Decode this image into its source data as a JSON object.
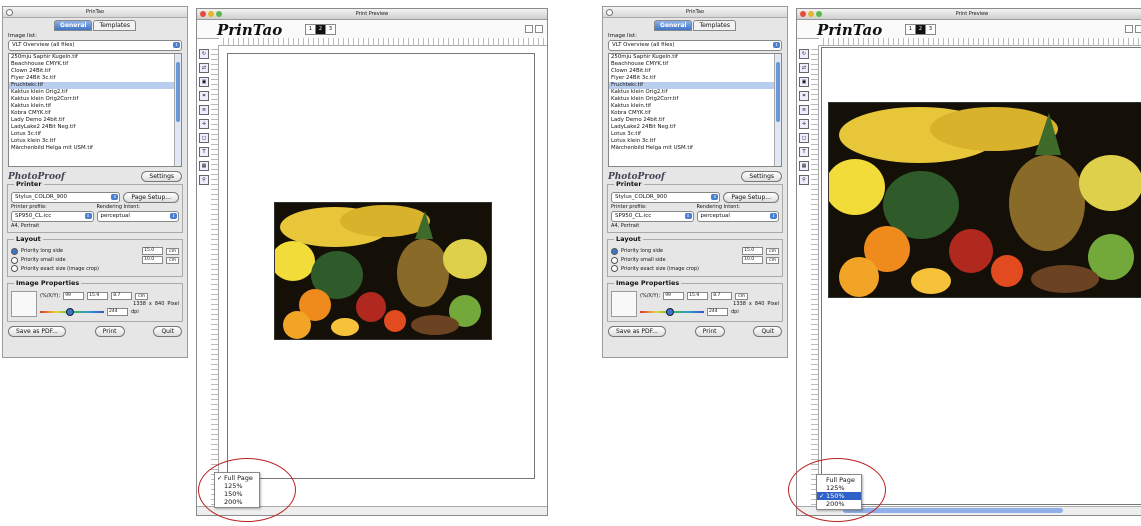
{
  "panel": {
    "title": "PrinTao",
    "tabs": [
      "General",
      "Templates"
    ],
    "image_list_label": "Image list:",
    "image_list_select": "VLT Overview (all files)",
    "files": [
      "250mju Saphir Kugeln.tif",
      "Beachhouse CMYK.tif",
      "Clown 24Bit.tif",
      "Flyer 24Bit 3c.tif",
      "Fruchteki.tif",
      "Kaktus klein Orig2.tif",
      "Kaktus klein Orig2Corr.tif",
      "Kaktus klein.tif",
      "Kobra CMYK.tif",
      "Lady Demo 24bit.tif",
      "LadyLake2 24Bit Neg.tif",
      "Lotus 3c.tif",
      "Lotus klein 3c.tif",
      "Märchenbild Helga mit USM.tif"
    ],
    "selected_file_index": 4,
    "photoproof_logo": "PhotoProof",
    "settings_button": "Settings",
    "printer": {
      "title": "Printer",
      "printer_select": "Stylus_COLOR_900",
      "page_setup_button": "Page Setup...",
      "profile_label": "Printer profile:",
      "profile_select": "SP950_CL.icc",
      "intent_label": "Rendering Intent:",
      "intent_select": "perceptual",
      "paper": "A4, Portrait"
    },
    "layout": {
      "title": "Layout",
      "options": [
        {
          "label": "Priority  long side",
          "value": "15.0",
          "unit": "cm",
          "selected": true
        },
        {
          "label": "Priority  small side",
          "value": "10.0",
          "unit": "cm",
          "selected": false
        },
        {
          "label": "Priority  exact size (image crop)",
          "value": "",
          "unit": "",
          "selected": false
        }
      ]
    },
    "image_properties": {
      "title": "Image Properties",
      "dims_label": "(%/X/Y):",
      "pct": "99",
      "x": "15.9",
      "y": "8.7",
      "dims_unit": "cm",
      "px_w": "1338",
      "px_x": "x",
      "px_h": "840",
      "px_unit": "Pixel",
      "dpi": "244",
      "dpi_unit": "dpi"
    },
    "buttons": {
      "save_pdf": "Save as PDF...",
      "print": "Print",
      "quit": "Quit"
    }
  },
  "preview": {
    "title": "Print Preview",
    "brand": "PrinTao",
    "pages": [
      "1",
      "2",
      "3"
    ],
    "active_page": "2",
    "zoom_options": [
      "Full Page",
      "125%",
      "150%",
      "200%"
    ]
  },
  "left": {
    "checked_zoom": "Full Page",
    "highlighted_zoom": ""
  },
  "right": {
    "checked_zoom": "150%",
    "highlighted_zoom": "150%"
  },
  "colors": {
    "accent": "#3f74c8",
    "highlight": "#2d63c8",
    "annotation_circle": "#b22222"
  }
}
